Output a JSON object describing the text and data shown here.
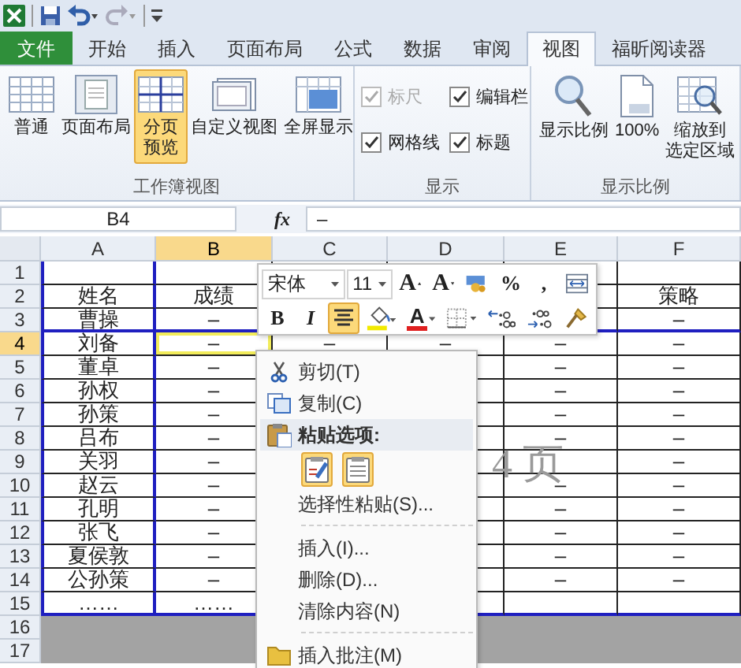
{
  "ribbon_tabs": [
    {
      "label": "文件",
      "kind": "file",
      "selected": false
    },
    {
      "label": "开始",
      "kind": "tab",
      "selected": false
    },
    {
      "label": "插入",
      "kind": "tab",
      "selected": false
    },
    {
      "label": "页面布局",
      "kind": "tab",
      "selected": false
    },
    {
      "label": "公式",
      "kind": "tab",
      "selected": false
    },
    {
      "label": "数据",
      "kind": "tab",
      "selected": false
    },
    {
      "label": "审阅",
      "kind": "tab",
      "selected": false
    },
    {
      "label": "视图",
      "kind": "tab",
      "selected": true
    },
    {
      "label": "福昕阅读器",
      "kind": "tab",
      "selected": false
    }
  ],
  "ribbon_groups": [
    {
      "label": "工作簿视图",
      "kind": "buttons",
      "items": [
        {
          "label": "普通",
          "selected": false
        },
        {
          "label": "页面布局",
          "selected": false
        },
        {
          "label": [
            "分页",
            "预览"
          ],
          "selected": true
        },
        {
          "label": "自定义视图",
          "selected": false
        },
        {
          "label": "全屏显示",
          "selected": false
        }
      ]
    },
    {
      "label": "显示",
      "kind": "checkboxes",
      "items": [
        {
          "label": "标尺",
          "checked": true,
          "disabled": true
        },
        {
          "label": "编辑栏",
          "checked": true,
          "disabled": false
        },
        {
          "label": "网格线",
          "checked": true,
          "disabled": false
        },
        {
          "label": "标题",
          "checked": true,
          "disabled": false
        }
      ]
    },
    {
      "label": "显示比例",
      "kind": "buttons",
      "items": [
        {
          "label": "显示比例",
          "selected": false
        },
        {
          "label": "100%",
          "selected": false
        },
        {
          "label": [
            "缩放到",
            "选定区域"
          ],
          "selected": false
        }
      ]
    }
  ],
  "formula_bar": {
    "name_box": "B4",
    "function_label": "fx",
    "formula": "–"
  },
  "sheet": {
    "columns": [
      {
        "label": "A",
        "selected": false,
        "page_break_after": true
      },
      {
        "label": "B",
        "selected": true,
        "page_break_after": false
      },
      {
        "label": "C",
        "selected": false,
        "page_break_after": false
      },
      {
        "label": "D",
        "selected": false,
        "page_break_after": false
      },
      {
        "label": "E",
        "selected": false,
        "page_break_after": false
      },
      {
        "label": "F",
        "selected": false,
        "page_break_after": false
      }
    ],
    "rows": [
      {
        "header": "1",
        "selected": false,
        "in_print_area": true,
        "page_break_after": false,
        "cells": [
          null,
          null,
          null,
          null,
          null,
          null
        ]
      },
      {
        "header": "2",
        "selected": false,
        "in_print_area": true,
        "page_break_after": false,
        "cells": [
          "姓名",
          "成绩",
          null,
          null,
          null,
          "策略"
        ]
      },
      {
        "header": "3",
        "selected": false,
        "in_print_area": true,
        "page_break_after": true,
        "cells": [
          "曹操",
          "–",
          null,
          null,
          null,
          "–"
        ]
      },
      {
        "header": "4",
        "selected": true,
        "in_print_area": true,
        "page_break_after": false,
        "cells": [
          "刘备",
          "–",
          "–",
          "–",
          "–",
          "–"
        ]
      },
      {
        "header": "5",
        "selected": false,
        "in_print_area": true,
        "page_break_after": false,
        "cells": [
          "董卓",
          "–",
          null,
          null,
          "–",
          "–"
        ]
      },
      {
        "header": "6",
        "selected": false,
        "in_print_area": true,
        "page_break_after": false,
        "cells": [
          "孙权",
          "–",
          null,
          null,
          "–",
          "–"
        ]
      },
      {
        "header": "7",
        "selected": false,
        "in_print_area": true,
        "page_break_after": false,
        "cells": [
          "孙策",
          "–",
          null,
          null,
          "–",
          "–"
        ]
      },
      {
        "header": "8",
        "selected": false,
        "in_print_area": true,
        "page_break_after": false,
        "cells": [
          "吕布",
          "–",
          null,
          null,
          "–",
          "–"
        ]
      },
      {
        "header": "9",
        "selected": false,
        "in_print_area": true,
        "page_break_after": false,
        "cells": [
          "关羽",
          "–",
          null,
          null,
          null,
          "–"
        ]
      },
      {
        "header": "10",
        "selected": false,
        "in_print_area": true,
        "page_break_after": false,
        "cells": [
          "赵云",
          "–",
          null,
          null,
          "–",
          "–"
        ]
      },
      {
        "header": "11",
        "selected": false,
        "in_print_area": true,
        "page_break_after": false,
        "cells": [
          "孔明",
          "–",
          null,
          null,
          "–",
          "–"
        ]
      },
      {
        "header": "12",
        "selected": false,
        "in_print_area": true,
        "page_break_after": false,
        "cells": [
          "张飞",
          "–",
          null,
          null,
          "–",
          "–"
        ]
      },
      {
        "header": "13",
        "selected": false,
        "in_print_area": true,
        "page_break_after": false,
        "cells": [
          "夏侯敦",
          "–",
          null,
          null,
          "–",
          "–"
        ]
      },
      {
        "header": "14",
        "selected": false,
        "in_print_area": true,
        "page_break_after": false,
        "cells": [
          "公孙策",
          "–",
          null,
          null,
          "–",
          "–"
        ]
      },
      {
        "header": "15",
        "selected": false,
        "in_print_area": true,
        "page_break_after": false,
        "cells": [
          "……",
          "……",
          null,
          null,
          null,
          null
        ]
      },
      {
        "header": "16",
        "selected": false,
        "in_print_area": false,
        "page_break_after": false,
        "cells": [
          null,
          null,
          null,
          null,
          null,
          null
        ]
      },
      {
        "header": "17",
        "selected": false,
        "in_print_area": false,
        "page_break_after": false,
        "cells": [
          null,
          null,
          null,
          null,
          null,
          null
        ]
      }
    ],
    "page_label": "4 页"
  },
  "mini_toolbar": {
    "font": "宋体",
    "size": "11",
    "rows": [
      [
        {
          "kind": "grow",
          "label": "A",
          "selected": false
        },
        {
          "kind": "shrink",
          "label": "A",
          "selected": false
        },
        {
          "kind": "icon",
          "selected": false
        },
        {
          "kind": "glyph",
          "label": "%",
          "selected": false
        },
        {
          "kind": "glyph",
          "label": ",",
          "selected": false
        },
        {
          "kind": "icon",
          "selected": false
        }
      ],
      [
        {
          "kind": "bold",
          "label": "B",
          "selected": false
        },
        {
          "kind": "italic",
          "label": "I",
          "selected": false
        },
        {
          "kind": "icon",
          "selected": true
        },
        {
          "kind": "icon",
          "selected": false
        },
        {
          "kind": "color",
          "label": "A",
          "selected": false
        },
        {
          "kind": "icon",
          "selected": false
        },
        {
          "kind": "icon",
          "selected": false
        },
        {
          "kind": "icon",
          "selected": false
        },
        {
          "kind": "icon",
          "selected": false
        }
      ]
    ]
  },
  "context_menu": [
    {
      "kind": "item",
      "label": "剪切(T)",
      "has_icon": true
    },
    {
      "kind": "item",
      "label": "复制(C)",
      "has_icon": true
    },
    {
      "kind": "heading",
      "label": "粘贴选项:",
      "has_icon": true
    },
    {
      "kind": "paste-options"
    },
    {
      "kind": "item",
      "label": "选择性粘贴(S)...",
      "has_icon": false
    },
    {
      "kind": "separator"
    },
    {
      "kind": "item",
      "label": "插入(I)...",
      "has_icon": false
    },
    {
      "kind": "item",
      "label": "删除(D)...",
      "has_icon": false
    },
    {
      "kind": "item",
      "label": "清除内容(N)",
      "has_icon": false
    },
    {
      "kind": "separator"
    },
    {
      "kind": "item",
      "label": "插入批注(M)",
      "has_icon": true
    }
  ]
}
